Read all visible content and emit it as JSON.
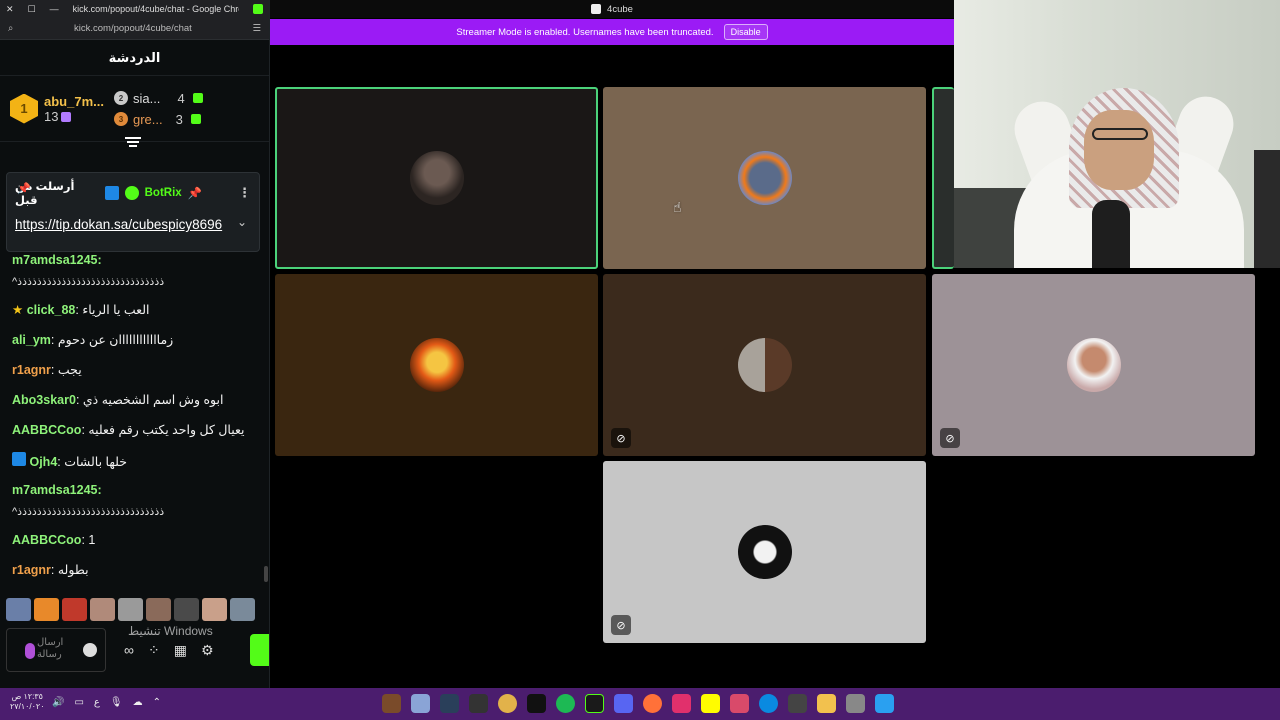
{
  "chrome": {
    "title": "kick.com/popout/4cube/chat - Google Chro...",
    "url": "kick.com/popout/4cube/chat"
  },
  "chat": {
    "header": "الدردشة",
    "leaderboard": {
      "first": {
        "rank": "1",
        "name": "abu_7m...",
        "count": "13"
      },
      "second": {
        "rank": "2",
        "name": "sia...",
        "count": "4"
      },
      "third": {
        "rank": "3",
        "name": "gre...",
        "count": "3"
      }
    },
    "pinned": {
      "label": "أرسلت من قبل",
      "bot": "BotRix",
      "link": "https://tip.dokan.sa/cubespicy8696"
    },
    "messages": [
      {
        "user": "m7amdsa1245:",
        "text": "",
        "sub": "^ذذذذذذذذذذذذذذذذذذذذذذذذذذذذذذ"
      },
      {
        "user": "click_88",
        "text": ": العب يا الرياء",
        "star": true
      },
      {
        "user": "ali_ym",
        "text": ": زماااااااااااان عن دحوم"
      },
      {
        "user": "r1agnr",
        "text": ": يجب",
        "orange": true
      },
      {
        "user": "Abo3skar0",
        "text": ": ابوه وش اسم الشخصيه ذي"
      },
      {
        "user": "AABBCCoo",
        "text": ": يعيال كل واحد يكتب رقم فعليه"
      },
      {
        "user": "Ojh4",
        "text": ": خلها بالشات",
        "badge": true
      },
      {
        "user": "m7amdsa1245:",
        "text": "",
        "sub": "^ذذذذذذذذذذذذذذذذذذذذذذذذذذذذذذ"
      },
      {
        "user": "AABBCCoo",
        "text": ": 1"
      },
      {
        "user": "r1agnr",
        "text": ": بطوله",
        "orange": true
      }
    ],
    "input_placeholder": "ارسال رسالة",
    "watermark": "تنشيط Windows"
  },
  "call": {
    "app_title": "4cube",
    "banner_text": "Streamer Mode is enabled. Usernames have been truncated.",
    "disable_label": "Disable",
    "mute_glyph": "⊘"
  },
  "taskbar": {
    "clock_time": "١٢:٣٥ ص",
    "clock_date": "٢٧/١٠/٠٢٠"
  },
  "colors": {
    "kick_green": "#53fc18",
    "banner_purple": "#9b1bf5",
    "taskbar": "#4b1d6e"
  }
}
